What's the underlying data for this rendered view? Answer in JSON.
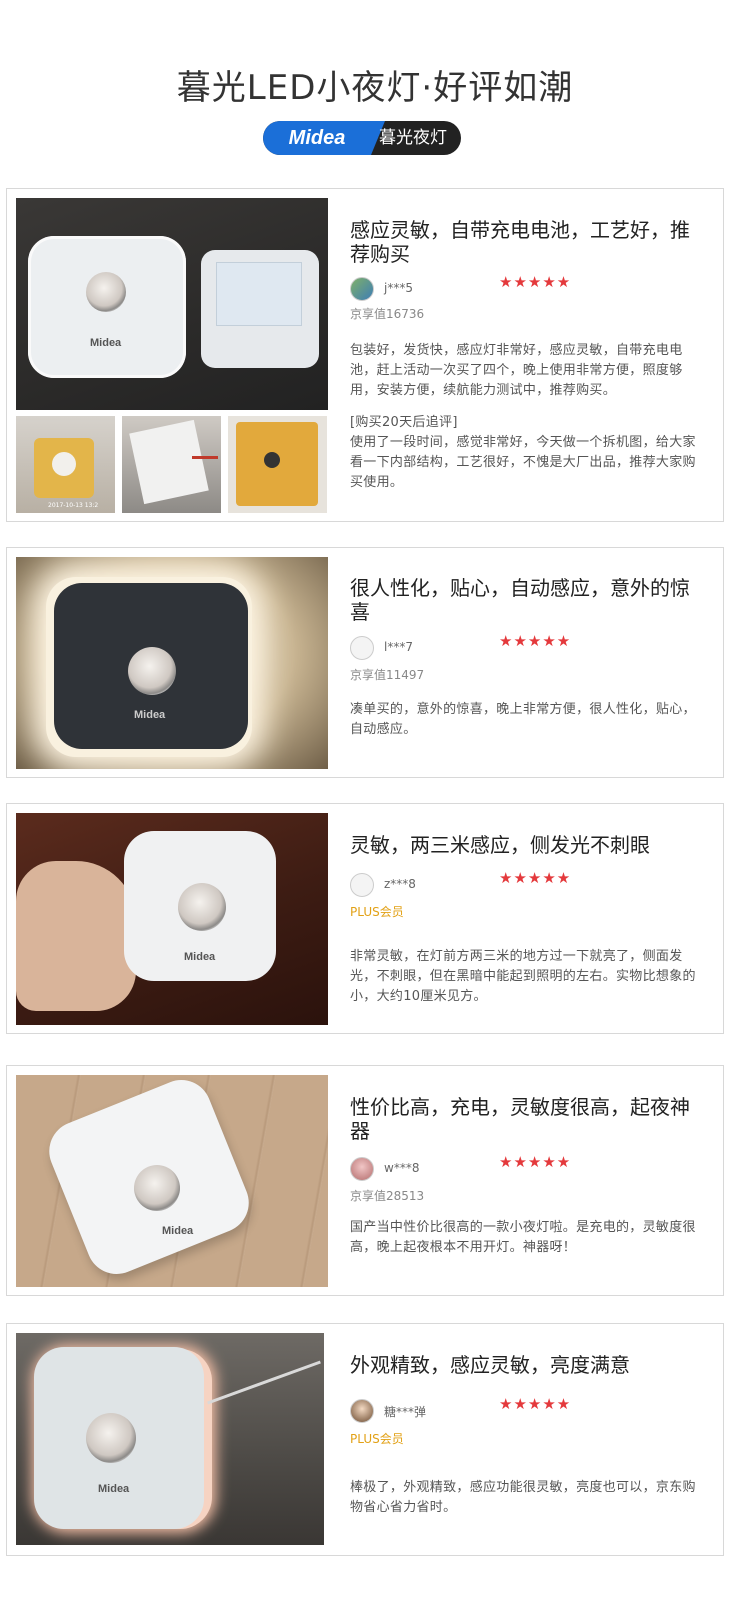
{
  "header": {
    "title": "暮光LED小夜灯·好评如潮",
    "badge_brand": "Midea",
    "badge_text": "暮光夜灯"
  },
  "reviews": [
    {
      "title": "感应灵敏，自带充电电池，工艺好，推荐购买",
      "user": "j***5",
      "stars": "★★★★★",
      "level": "京享值16736",
      "body": "包装好，发货快，感应灯非常好，感应灵敏，自带充电电池，赶上活动一次买了四个，晚上使用非常方便，照度够用，安装方便，续航能力测试中，推荐购买。",
      "followup": "[购买20天后追评]\n使用了一段时间，感觉非常好，今天做一个拆机图，给大家看一下内部结构，工艺很好，不愧是大厂出品，推荐大家购买使用。",
      "photo_logo": "Midea",
      "thumb_timestamp": "2017-10-13 13:2"
    },
    {
      "title": "很人性化，贴心，自动感应，意外的惊喜",
      "user": "l***7",
      "stars": "★★★★★",
      "level": "京享值11497",
      "body": "凑单买的，意外的惊喜，晚上非常方便，很人性化，贴心，自动感应。",
      "photo_logo": "Midea"
    },
    {
      "title": "灵敏，两三米感应，侧发光不刺眼",
      "user": "z***8",
      "stars": "★★★★★",
      "level": "PLUS会员",
      "body": "非常灵敏，在灯前方两三米的地方过一下就亮了，侧面发光，不刺眼，但在黑暗中能起到照明的左右。实物比想象的小，大约10厘米见方。",
      "photo_logo": "Midea"
    },
    {
      "title": "性价比高，充电，灵敏度很高，起夜神器",
      "user": "w***8",
      "stars": "★★★★★",
      "level": "京享值28513",
      "body": "国产当中性价比很高的一款小夜灯啦。是充电的，灵敏度很高，晚上起夜根本不用开灯。神器呀！",
      "photo_logo": "Midea"
    },
    {
      "title": "外观精致，感应灵敏，亮度满意",
      "user": "糖***弹",
      "stars": "★★★★★",
      "level": "PLUS会员",
      "body": "棒极了，外观精致，感应功能很灵敏，亮度也可以，京东购物省心省力省时。",
      "photo_logo": "Midea"
    }
  ],
  "colors": {
    "star": "#e4393c",
    "plus": "#e2a116",
    "brand_blue": "#1b6fd8"
  }
}
